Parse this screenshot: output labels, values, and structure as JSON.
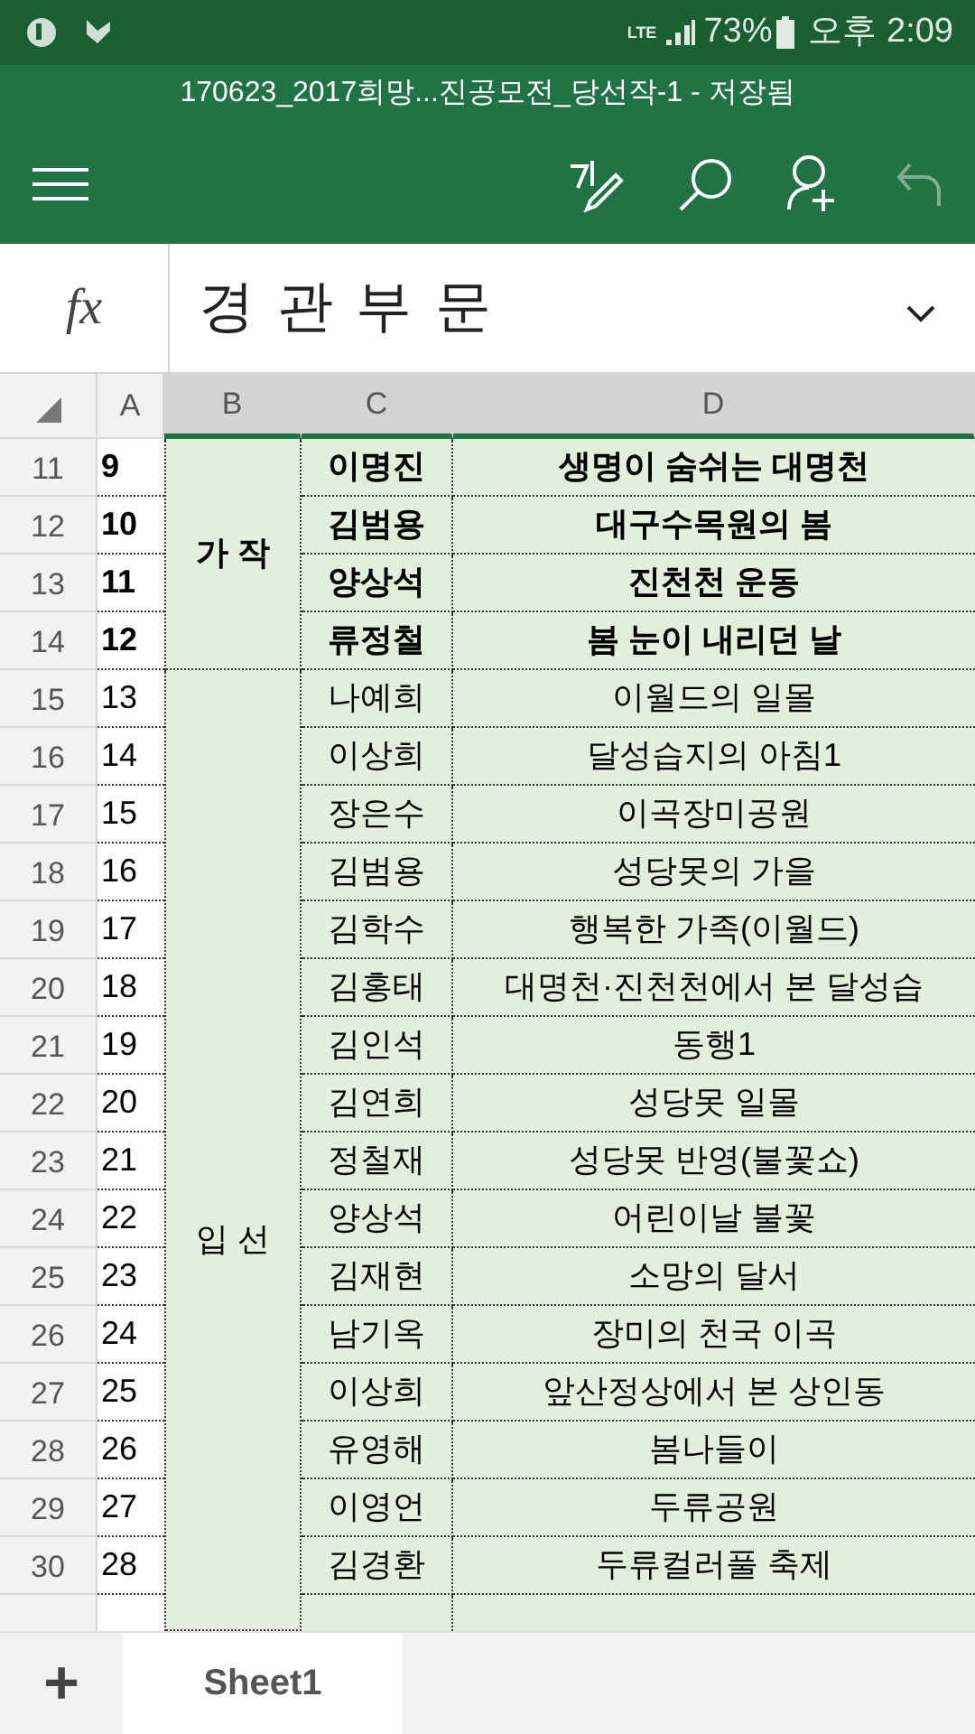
{
  "status_bar": {
    "network": "LTE",
    "battery": "73%",
    "time": "오후 2:09"
  },
  "window": {
    "title": "170623_2017희망...진공모전_당선작-1 - 저장됨"
  },
  "formula_bar": {
    "fx_label": "fx",
    "value": "경 관 부 문"
  },
  "columns": [
    {
      "label": "A",
      "selected": false
    },
    {
      "label": "B",
      "selected": true
    },
    {
      "label": "C",
      "selected": true
    },
    {
      "label": "D",
      "selected": true
    }
  ],
  "groups": [
    {
      "label": "가 작",
      "emphasized": true,
      "rows": [
        {
          "row": "11",
          "a": "9",
          "c": "이명진",
          "d": "생명이 숨쉬는 대명천"
        },
        {
          "row": "12",
          "a": "10",
          "c": "김범용",
          "d": "대구수목원의 봄"
        },
        {
          "row": "13",
          "a": "11",
          "c": "양상석",
          "d": "진천천 운동"
        },
        {
          "row": "14",
          "a": "12",
          "c": "류정철",
          "d": "봄 눈이 내리던 날"
        }
      ]
    },
    {
      "label": "입 선",
      "emphasized": false,
      "rows": [
        {
          "row": "15",
          "a": "13",
          "c": "나예희",
          "d": "이월드의 일몰"
        },
        {
          "row": "16",
          "a": "14",
          "c": "이상희",
          "d": "달성습지의 아침1"
        },
        {
          "row": "17",
          "a": "15",
          "c": "장은수",
          "d": "이곡장미공원"
        },
        {
          "row": "18",
          "a": "16",
          "c": "김범용",
          "d": "성당못의 가을"
        },
        {
          "row": "19",
          "a": "17",
          "c": "김학수",
          "d": "행복한 가족(이월드)"
        },
        {
          "row": "20",
          "a": "18",
          "c": "김홍태",
          "d": "대명천·진천천에서 본 달성습"
        },
        {
          "row": "21",
          "a": "19",
          "c": "김인석",
          "d": "동행1"
        },
        {
          "row": "22",
          "a": "20",
          "c": "김연희",
          "d": "성당못 일몰"
        },
        {
          "row": "23",
          "a": "21",
          "c": "정철재",
          "d": "성당못 반영(불꽃쇼)"
        },
        {
          "row": "24",
          "a": "22",
          "c": "양상석",
          "d": "어린이날 불꽃"
        },
        {
          "row": "25",
          "a": "23",
          "c": "김재현",
          "d": "소망의 달서"
        },
        {
          "row": "26",
          "a": "24",
          "c": "남기옥",
          "d": "장미의 천국 이곡"
        },
        {
          "row": "27",
          "a": "25",
          "c": "이상희",
          "d": "앞산정상에서 본 상인동"
        },
        {
          "row": "28",
          "a": "26",
          "c": "유영해",
          "d": "봄나들이"
        },
        {
          "row": "29",
          "a": "27",
          "c": "이영언",
          "d": "두류공원"
        },
        {
          "row": "30",
          "a": "28",
          "c": "김경환",
          "d": "두류컬러풀 축제"
        }
      ]
    }
  ],
  "sheet_tabs": {
    "add_label": "+",
    "tabs": [
      {
        "label": "Sheet1",
        "selected": true
      }
    ]
  }
}
